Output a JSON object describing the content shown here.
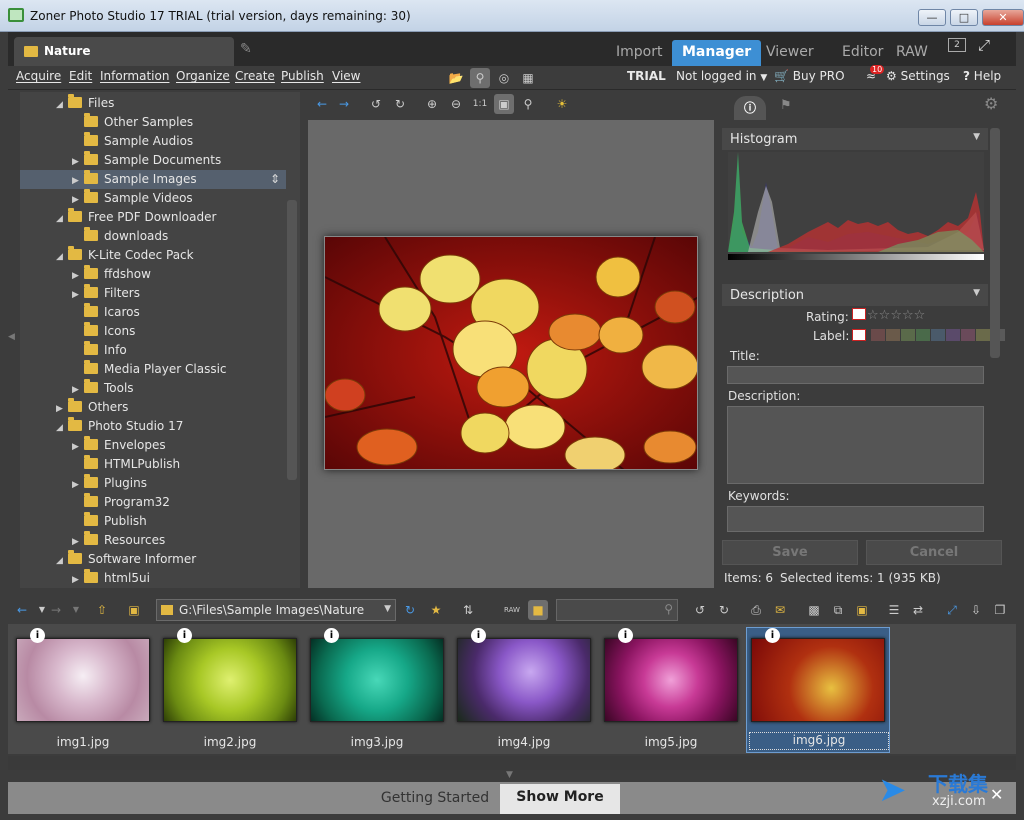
{
  "window": {
    "title": "Zoner Photo Studio 17 TRIAL (trial version, days remaining: 30)"
  },
  "tabs": {
    "current_folder": "Nature",
    "modes": [
      "Import",
      "Manager",
      "Viewer",
      "Editor",
      "RAW"
    ],
    "active_mode": "Manager",
    "badge_count": "2"
  },
  "menu": {
    "items": [
      "Acquire",
      "Edit",
      "Information",
      "Organize",
      "Create",
      "Publish",
      "View"
    ],
    "trial": "TRIAL",
    "account": "Not logged in",
    "buy": "Buy PRO",
    "notifications": "10",
    "settings": "Settings",
    "help": "Help"
  },
  "tree": [
    {
      "label": "Files",
      "level": 1,
      "expanded": true
    },
    {
      "label": "Other Samples",
      "level": 2
    },
    {
      "label": "Sample Audios",
      "level": 2
    },
    {
      "label": "Sample Documents",
      "level": 2,
      "collapsed": true
    },
    {
      "label": "Sample Images",
      "level": 2,
      "collapsed": true,
      "selected": true
    },
    {
      "label": "Sample Videos",
      "level": 2,
      "collapsed": true
    },
    {
      "label": "Free PDF Downloader",
      "level": 1,
      "expanded": true
    },
    {
      "label": "downloads",
      "level": 2
    },
    {
      "label": "K-Lite Codec Pack",
      "level": 1,
      "expanded": true
    },
    {
      "label": "ffdshow",
      "level": 2,
      "collapsed": true
    },
    {
      "label": "Filters",
      "level": 2,
      "collapsed": true
    },
    {
      "label": "Icaros",
      "level": 2
    },
    {
      "label": "Icons",
      "level": 2
    },
    {
      "label": "Info",
      "level": 2
    },
    {
      "label": "Media Player Classic",
      "level": 2
    },
    {
      "label": "Tools",
      "level": 2,
      "collapsed": true
    },
    {
      "label": "Others",
      "level": 1,
      "collapsed": true
    },
    {
      "label": "Photo Studio 17",
      "level": 1,
      "expanded": true
    },
    {
      "label": "Envelopes",
      "level": 2,
      "collapsed": true
    },
    {
      "label": "HTMLPublish",
      "level": 2
    },
    {
      "label": "Plugins",
      "level": 2,
      "collapsed": true
    },
    {
      "label": "Program32",
      "level": 2
    },
    {
      "label": "Publish",
      "level": 2
    },
    {
      "label": "Resources",
      "level": 2,
      "collapsed": true
    },
    {
      "label": "Software Informer",
      "level": 1,
      "expanded": true
    },
    {
      "label": "html5ui",
      "level": 2,
      "collapsed": true
    }
  ],
  "panel": {
    "histogram": "Histogram",
    "description": "Description",
    "rating_label": "Rating:",
    "label_label": "Label:",
    "title_label": "Title:",
    "description_label": "Description:",
    "keywords_label": "Keywords:",
    "save": "Save",
    "cancel": "Cancel",
    "items": "Items: 6",
    "selected": "Selected items: 1 (935 KB)",
    "label_colors": [
      "#6a4a4a",
      "#6a5a4a",
      "#5a6a4a",
      "#4a6a4a",
      "#4a5a6a",
      "#5a4a6a",
      "#6a4a5a",
      "#6a6a4a",
      "#5a5a5a"
    ]
  },
  "path": "G:\\Files\\Sample Images\\Nature",
  "thumbnails": [
    {
      "name": "img1.jpg",
      "bg": "radial-gradient(circle at 50% 45%,#f6eef4 0,#d8b8cc 35%,#b88aa4 70%,#c9a9bb 100%)"
    },
    {
      "name": "img2.jpg",
      "bg": "radial-gradient(circle at 50% 50%,#dff070 0,#a8c826 40%,#6a8a12 75%,#2e3f06 100%)"
    },
    {
      "name": "img3.jpg",
      "bg": "radial-gradient(circle at 50% 50%,#48d8b8 0,#16a888 40%,#0a6a50 75%,#043024 100%)"
    },
    {
      "name": "img4.jpg",
      "bg": "radial-gradient(circle at 55% 40%,#c8a8f0 0,#8a58c8 35%,#4a2a6a 65%,#1a2a1a 100%)"
    },
    {
      "name": "img5.jpg",
      "bg": "radial-gradient(circle at 50% 50%,#f0a0d8 0,#c83a96 35%,#8a1460 65%,#3a0624 100%)"
    },
    {
      "name": "img6.jpg",
      "bg": "radial-gradient(circle at 60% 60%,#e8c040 0,#b03010 45%,#7a0808 100%)",
      "selected": true
    }
  ],
  "footer": {
    "getting_started": "Getting Started",
    "show_more": "Show More"
  },
  "watermark": {
    "text": "下载集",
    "url": "xzji.com"
  }
}
